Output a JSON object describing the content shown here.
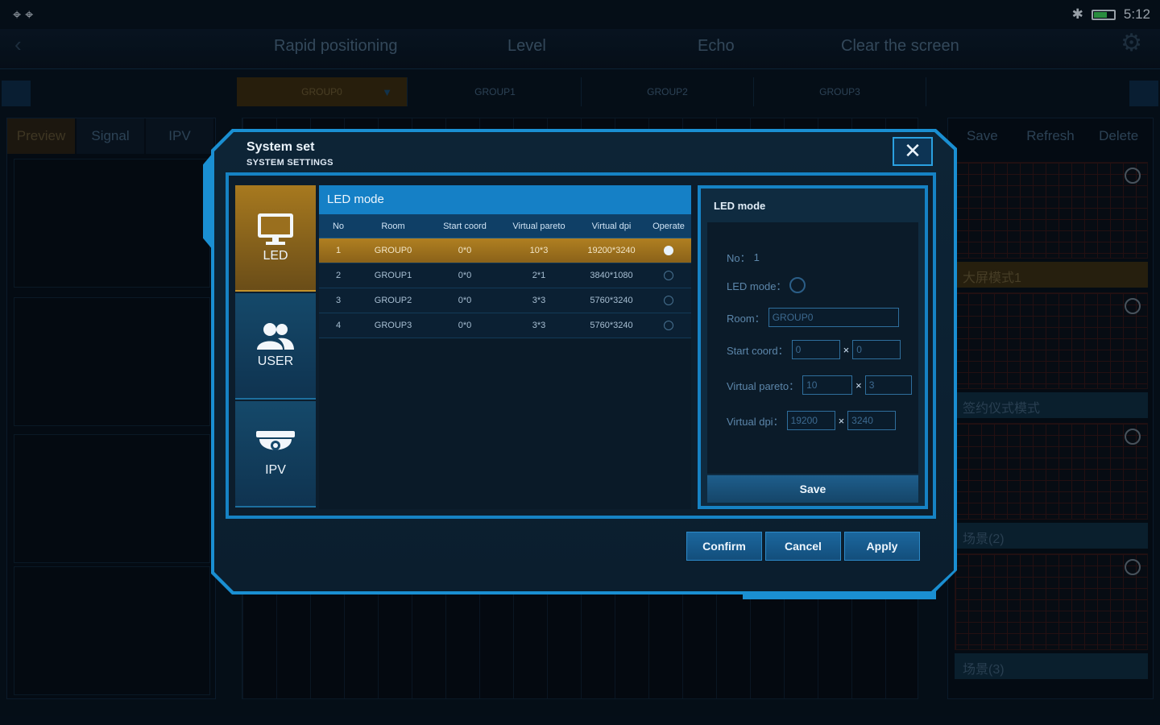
{
  "status": {
    "left_icons": "⌖ ⌖",
    "right": "5:12"
  },
  "topnav": {
    "tabs": [
      "Rapid positioning",
      "Level",
      "Echo",
      "Clear the screen"
    ]
  },
  "groups": [
    "GROUP0",
    "GROUP1",
    "GROUP2",
    "GROUP3"
  ],
  "left_tabs": [
    "Preview",
    "Signal",
    "IPV"
  ],
  "right_tabs": [
    "Save",
    "Refresh",
    "Delete"
  ],
  "scenes": [
    "大屏模式1",
    "签约仪式模式",
    "场景(2)",
    "场景(3)"
  ],
  "dialog": {
    "title": "System set",
    "subtitle": "SYSTEM SETTINGS",
    "close": "✕",
    "sidebar": [
      {
        "label": "LED",
        "icon": "monitor-icon"
      },
      {
        "label": "USER",
        "icon": "users-icon"
      },
      {
        "label": "IPV",
        "icon": "camera-icon"
      }
    ],
    "table": {
      "heading": "LED mode",
      "columns": [
        "No",
        "Room",
        "Start coord",
        "Virtual pareto",
        "Virtual dpi",
        "Operate"
      ],
      "rows": [
        {
          "no": "1",
          "room": "GROUP0",
          "start": "0*0",
          "pareto": "10*3",
          "dpi": "19200*3240",
          "selected": true
        },
        {
          "no": "2",
          "room": "GROUP1",
          "start": "0*0",
          "pareto": "2*1",
          "dpi": "3840*1080",
          "selected": false
        },
        {
          "no": "3",
          "room": "GROUP2",
          "start": "0*0",
          "pareto": "3*3",
          "dpi": "5760*3240",
          "selected": false
        },
        {
          "no": "4",
          "room": "GROUP3",
          "start": "0*0",
          "pareto": "3*3",
          "dpi": "5760*3240",
          "selected": false
        }
      ]
    },
    "detail": {
      "title": "LED mode",
      "no_label": "No：",
      "no_value": "1",
      "mode_label": "LED mode：",
      "room_label": "Room：",
      "room_value": "GROUP0",
      "start_label": "Start coord：",
      "start_x": "0",
      "start_y": "0",
      "pareto_label": "Virtual pareto：",
      "pareto_x": "10",
      "pareto_y": "3",
      "dpi_label": "Virtual dpi：",
      "dpi_x": "19200",
      "dpi_y": "3240",
      "times": "×",
      "save": "Save"
    },
    "buttons": {
      "confirm": "Confirm",
      "cancel": "Cancel",
      "apply": "Apply"
    }
  }
}
